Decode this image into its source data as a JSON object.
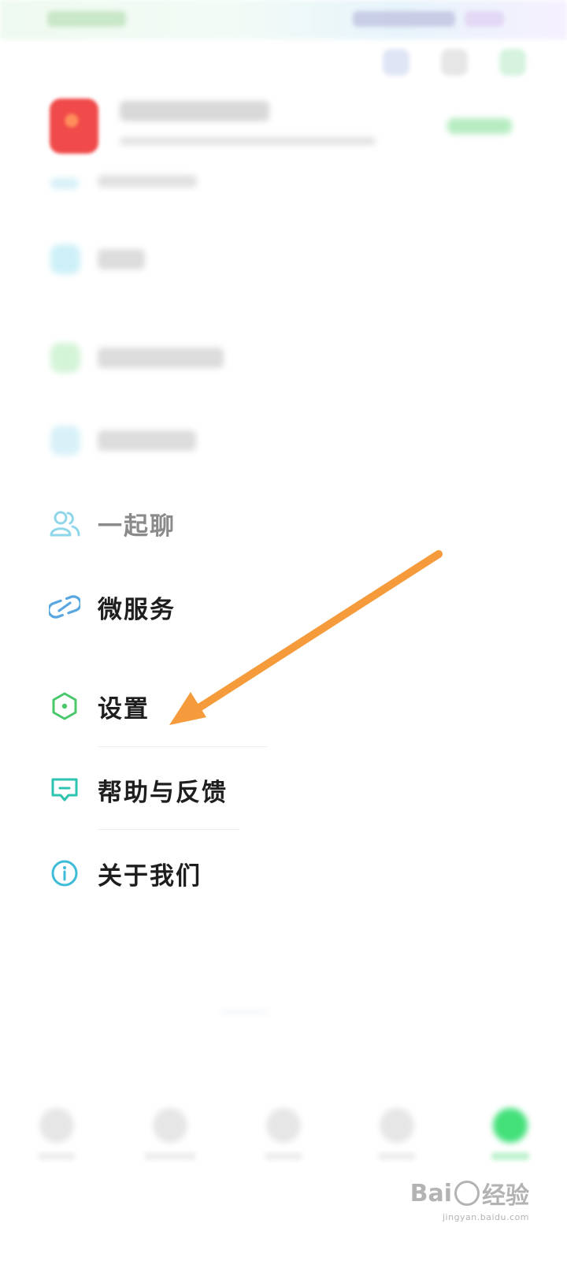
{
  "menu": {
    "items": [
      {
        "label": "一起聊",
        "icon": "users-icon"
      },
      {
        "label": "微服务",
        "icon": "link-icon"
      },
      {
        "label": "设置",
        "icon": "settings-hexagon-icon"
      },
      {
        "label": "帮助与反馈",
        "icon": "feedback-icon"
      },
      {
        "label": "关于我们",
        "icon": "info-icon"
      }
    ]
  },
  "colors": {
    "icon_blue": "#4ec3e0",
    "icon_green": "#49c86b",
    "icon_teal": "#2cc3b0",
    "arrow_orange": "#f59b3c",
    "active_tab_green": "#43e07a"
  },
  "watermark": {
    "logo_text_a": "Bai",
    "logo_text_b": "经验",
    "url": "jingyan.baidu.com"
  }
}
